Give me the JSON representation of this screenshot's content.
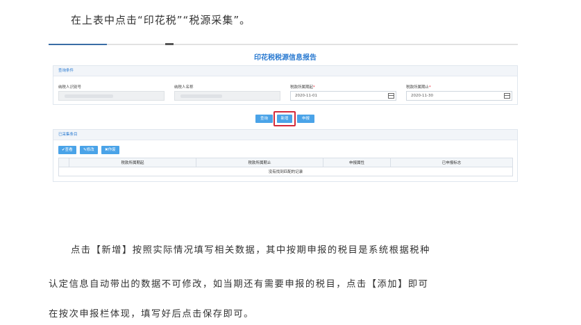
{
  "intro_text": "在上表中点击“印花税”“税源采集”。",
  "app": {
    "title": "印花税税源信息报告",
    "query_panel": {
      "title": "查询条件",
      "fields": [
        {
          "label": "纳税人识别号",
          "value": "",
          "required": false
        },
        {
          "label": "纳税人名称",
          "value": "",
          "required": false
        },
        {
          "label": "税款所属期起",
          "value": "2020-11-01",
          "required": true
        },
        {
          "label": "税款所属期止",
          "value": "2020-11-30",
          "required": true
        }
      ],
      "required_mark": "*"
    },
    "actions": {
      "query": "查询",
      "add": "新增",
      "declare": "申报"
    },
    "collected_panel": {
      "title": "已采集条目",
      "toolbar": {
        "view": "查看",
        "edit": "修改",
        "void": "作废"
      },
      "columns": [
        "税款所属期起",
        "税款所属期止",
        "申报属性",
        "已申报标志"
      ],
      "empty_message": "没有找到匹配的记录"
    }
  },
  "body_text": {
    "line1": "点击【新增】按照实际情况填写相关数据，其中按期申报的税目是系统根据税种",
    "line2": "认定信息自动带出的数据不可修改，如当期还有需要申报的税目，点击【添加】即可",
    "line3": "在按次申报栏体现，填写好后点击保存即可。"
  },
  "colors": {
    "accent": "#2b7bd1",
    "button": "#4aa3e8",
    "highlight": "#d42a3a"
  }
}
